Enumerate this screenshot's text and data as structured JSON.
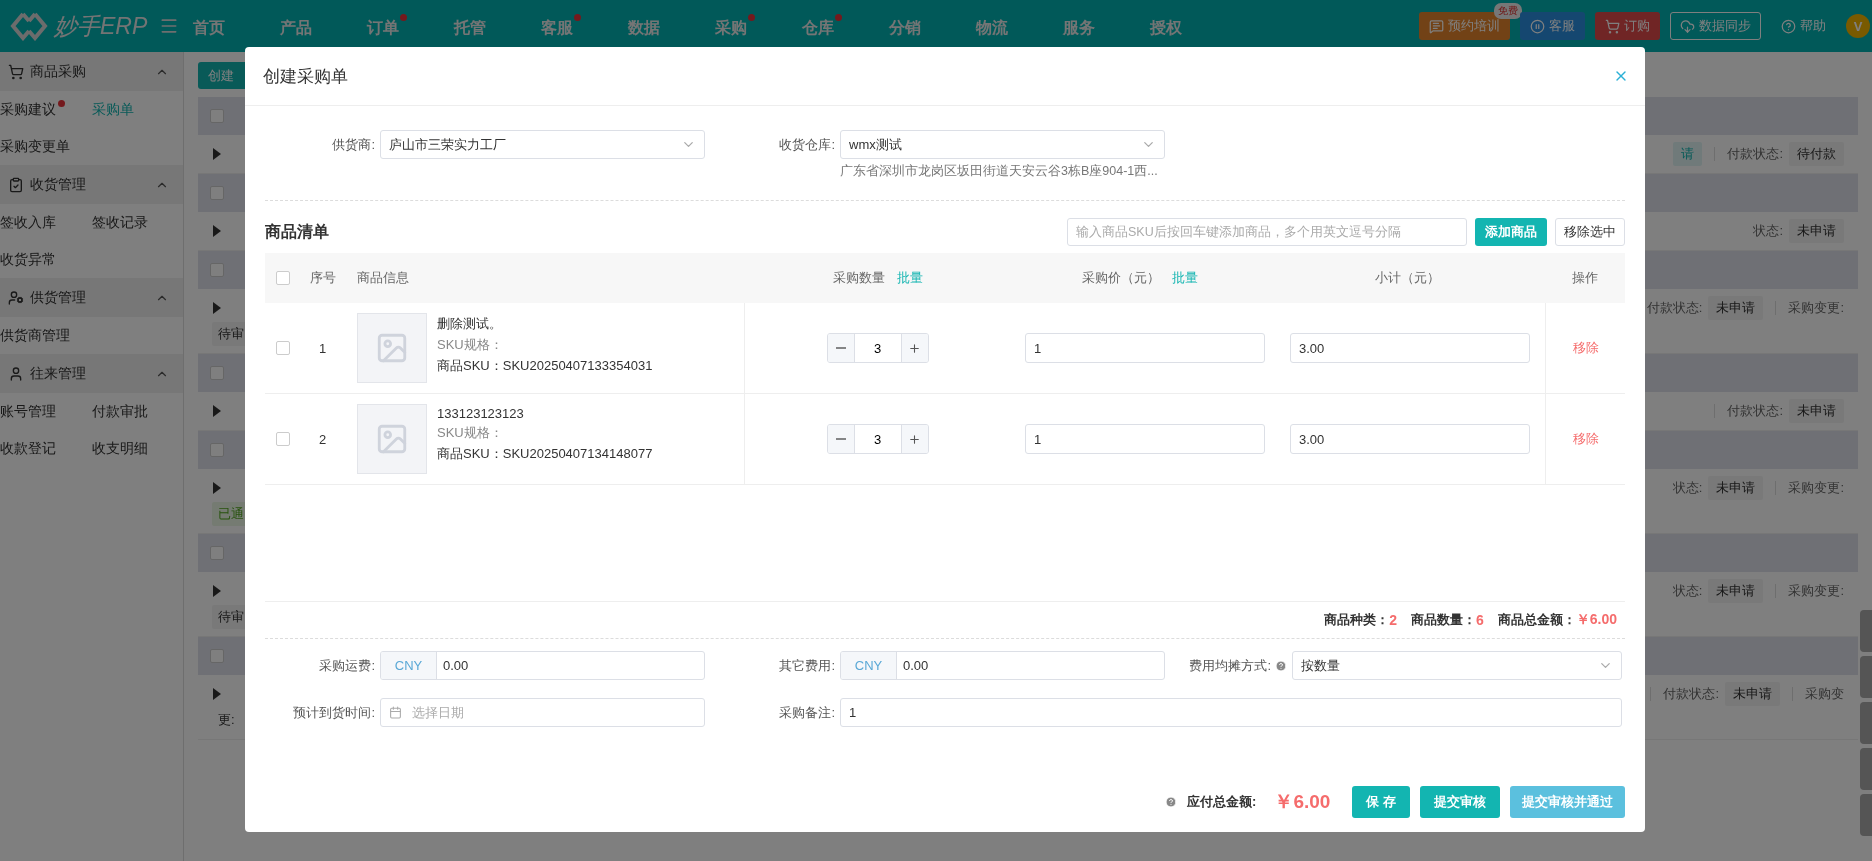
{
  "top_nav": {
    "logo": "妙手ERP",
    "menu": [
      {
        "label": "首页",
        "dot": false
      },
      {
        "label": "产品",
        "dot": false
      },
      {
        "label": "订单",
        "dot": true
      },
      {
        "label": "托管",
        "dot": false
      },
      {
        "label": "客服",
        "dot": true
      },
      {
        "label": "数据",
        "dot": false
      },
      {
        "label": "采购",
        "dot": true
      },
      {
        "label": "仓库",
        "dot": true
      },
      {
        "label": "分销",
        "dot": false
      },
      {
        "label": "物流",
        "dot": false
      },
      {
        "label": "服务",
        "dot": false
      },
      {
        "label": "授权",
        "dot": false
      }
    ],
    "actions": [
      {
        "kind": "training",
        "label": "预约培训",
        "badge": "免费"
      },
      {
        "kind": "service",
        "label": "客服"
      },
      {
        "kind": "order",
        "label": "订购"
      },
      {
        "kind": "sync",
        "label": "数据同步"
      },
      {
        "kind": "help",
        "label": "帮助"
      }
    ],
    "avatar": "V"
  },
  "sidebar": {
    "groups": [
      {
        "kind": "cart",
        "title": "商品采购",
        "expanded": true,
        "items": [
          {
            "label": "采购建议",
            "dot": true,
            "selected": false
          },
          {
            "label": "采购单",
            "dot": false,
            "selected": true
          },
          {
            "label": "采购变更单",
            "dot": false,
            "selected": false
          }
        ]
      },
      {
        "kind": "clipboard",
        "title": "收货管理",
        "expanded": true,
        "items": [
          {
            "label": "签收入库",
            "dot": false,
            "selected": false
          },
          {
            "label": "签收记录",
            "dot": false,
            "selected": false
          },
          {
            "label": "收货异常",
            "dot": false,
            "selected": false
          }
        ]
      },
      {
        "kind": "supplier",
        "title": "供货管理",
        "expanded": true,
        "items": [
          {
            "label": "供货商管理",
            "dot": false,
            "selected": false
          }
        ]
      },
      {
        "kind": "person",
        "title": "往来管理",
        "expanded": true,
        "items": [
          {
            "label": "账号管理",
            "dot": false,
            "selected": false
          },
          {
            "label": "付款审批",
            "dot": false,
            "selected": false
          },
          {
            "label": "收款登记",
            "dot": false,
            "selected": false
          },
          {
            "label": "收支明细",
            "dot": false,
            "selected": false
          }
        ]
      }
    ]
  },
  "purchase_list": {
    "create_button": "创建",
    "rows": [
      {
        "checked": false,
        "statuses": [
          {
            "kind": "teal_tag",
            "text": "请"
          },
          {
            "kind": "divider"
          },
          {
            "kind": "label",
            "text": "付款状态:"
          },
          {
            "kind": "tag",
            "text": "待付款"
          }
        ]
      },
      {
        "checked": false,
        "statuses": [
          {
            "kind": "label",
            "text": "状态:"
          },
          {
            "kind": "tag",
            "text": "未申请"
          }
        ]
      },
      {
        "checked": false,
        "left": {
          "kind": "pending",
          "text": "待审"
        },
        "statuses": [
          {
            "kind": "label",
            "text": "付款状态:"
          },
          {
            "kind": "tag",
            "text": "未申请"
          },
          {
            "kind": "divider"
          },
          {
            "kind": "label",
            "text": "采购变更:"
          }
        ]
      },
      {
        "checked": false,
        "statuses": [
          {
            "kind": "divider"
          },
          {
            "kind": "label",
            "text": "付款状态:"
          },
          {
            "kind": "tag",
            "text": "未申请"
          }
        ]
      },
      {
        "checked": false,
        "left": {
          "kind": "passed",
          "text": "已通"
        },
        "statuses": [
          {
            "kind": "label",
            "text": "状态:"
          },
          {
            "kind": "tag",
            "text": "未申请"
          },
          {
            "kind": "divider"
          },
          {
            "kind": "label",
            "text": "采购变更:"
          }
        ]
      },
      {
        "checked": false,
        "left": {
          "kind": "pending",
          "text": "待审"
        },
        "statuses": [
          {
            "kind": "label",
            "text": "状态:"
          },
          {
            "kind": "tag",
            "text": "未申请"
          },
          {
            "kind": "divider"
          },
          {
            "kind": "label",
            "text": "采购变更:"
          }
        ]
      },
      {
        "checked": false,
        "left": {
          "kind": "text",
          "text": "更:"
        },
        "statuses": [
          {
            "kind": "divider"
          },
          {
            "kind": "label",
            "text": "付款状态:"
          },
          {
            "kind": "tag",
            "text": "未申请"
          },
          {
            "kind": "divider"
          },
          {
            "kind": "label",
            "text": "采购变"
          }
        ]
      }
    ]
  },
  "modal": {
    "title": "创建采购单",
    "supplier": {
      "label": "供货商:",
      "value": "庐山市三荣实力工厂"
    },
    "warehouse": {
      "label": "收货仓库:",
      "value": "wmx测试",
      "address": "广东省深圳市龙岗区坂田街道天安云谷3栋B座904-1西..."
    },
    "items_section": {
      "title": "商品清单",
      "sku_input": {
        "placeholder": "输入商品SKU后按回车键添加商品，多个用英文逗号分隔"
      },
      "add_button": "添加商品",
      "remove_button": "移除选中"
    },
    "table": {
      "select_all_checked": false,
      "columns": [
        {
          "label": "序号"
        },
        {
          "label": "商品信息"
        },
        {
          "label": "采购数量",
          "link": "批量"
        },
        {
          "label": "采购价（元）",
          "link": "批量"
        },
        {
          "label": "小计（元）"
        },
        {
          "label": "操作"
        }
      ],
      "rows": [
        {
          "checked": false,
          "index": "1",
          "name": "删除测试。",
          "spec": "SKU规格：",
          "sku": "商品SKU：SKU20250407133354031",
          "quantity": "3",
          "price": "1",
          "subtotal": "3.00",
          "action": "移除"
        },
        {
          "checked": false,
          "index": "2",
          "name": "133123123123",
          "spec": "SKU规格：",
          "sku": "商品SKU：SKU20250407134148077",
          "quantity": "3",
          "price": "1",
          "subtotal": "3.00",
          "action": "移除"
        }
      ]
    },
    "summary": [
      {
        "label": "商品种类：",
        "value": "2"
      },
      {
        "label": "商品数量：",
        "value": "6"
      },
      {
        "label": "商品总金额：",
        "value": "￥6.00"
      }
    ],
    "fees": [
      {
        "kind": "currency",
        "label": "采购运费:",
        "currency": "CNY",
        "value": "0.00",
        "help": false
      },
      {
        "kind": "currency",
        "label": "其它费用:",
        "currency": "CNY",
        "value": "0.00",
        "help": false
      },
      {
        "kind": "select",
        "label": "费用均摊方式:",
        "value": "按数量",
        "help": true
      },
      {
        "kind": "date",
        "label": "预计到货时间:",
        "placeholder": "选择日期",
        "help": false
      },
      {
        "kind": "text",
        "label": "采购备注:",
        "value": "1",
        "help": false
      }
    ],
    "footer": {
      "total_label": "应付总金额:",
      "total": "￥6.00",
      "buttons": [
        {
          "kind": "primary",
          "label": "保 存"
        },
        {
          "kind": "primary",
          "label": "提交审核"
        },
        {
          "kind": "info",
          "label": "提交审核并通过"
        }
      ]
    }
  }
}
